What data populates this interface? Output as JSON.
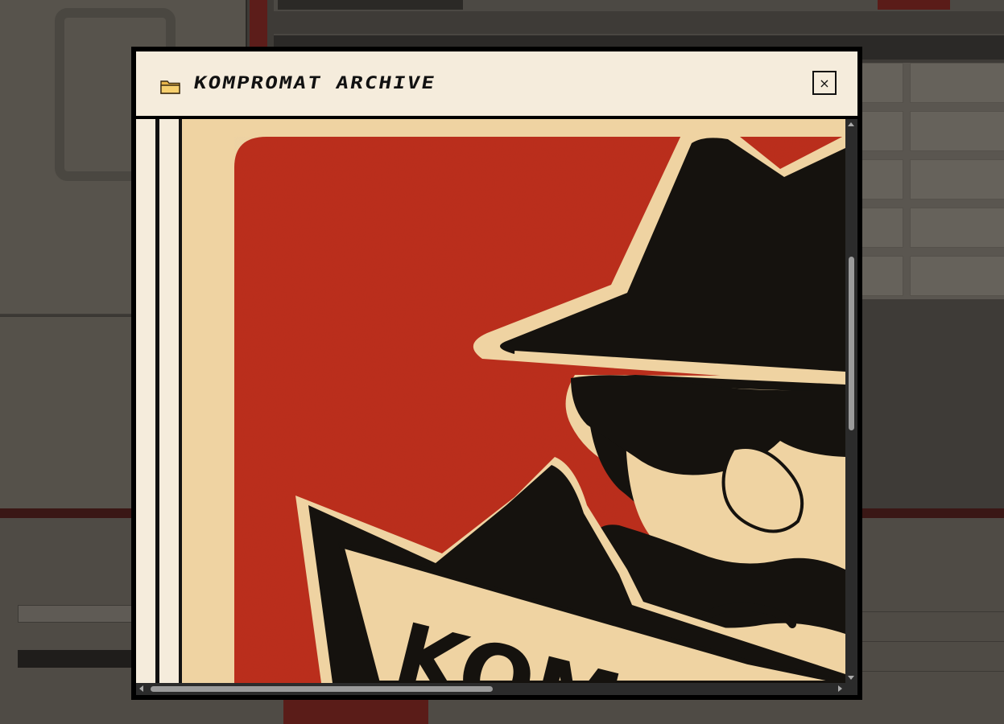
{
  "modal": {
    "title": "KOMPROMAT ARCHIVE",
    "close_label": "×",
    "folder_icon": "folder-icon",
    "close_icon": "close-icon"
  },
  "poster": {
    "visible_letters": "KOM",
    "colors": {
      "background": "#f0d7a8",
      "panel_red": "#b92d1a",
      "ink": "#15120e",
      "paper": "#f5ecdc"
    }
  },
  "scrollbars": {
    "vertical_position": 0.24,
    "horizontal_position": 0.02
  },
  "theme": {
    "overlay": "#3e3b37",
    "modal_border": "#000000",
    "header_bg": "#f5ecdc"
  }
}
